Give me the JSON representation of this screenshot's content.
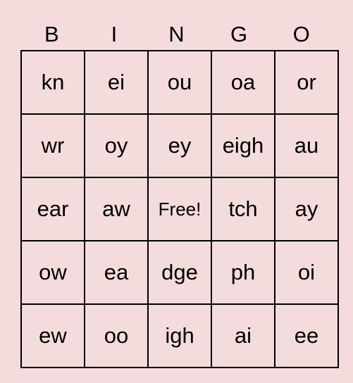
{
  "header": [
    "B",
    "I",
    "N",
    "G",
    "O"
  ],
  "rows": [
    [
      "kn",
      "ei",
      "ou",
      "oa",
      "or"
    ],
    [
      "wr",
      "oy",
      "ey",
      "eigh",
      "au"
    ],
    [
      "ear",
      "aw",
      "Free!",
      "tch",
      "ay"
    ],
    [
      "ow",
      "ea",
      "dge",
      "ph",
      "oi"
    ],
    [
      "ew",
      "oo",
      "igh",
      "ai",
      "ee"
    ]
  ]
}
